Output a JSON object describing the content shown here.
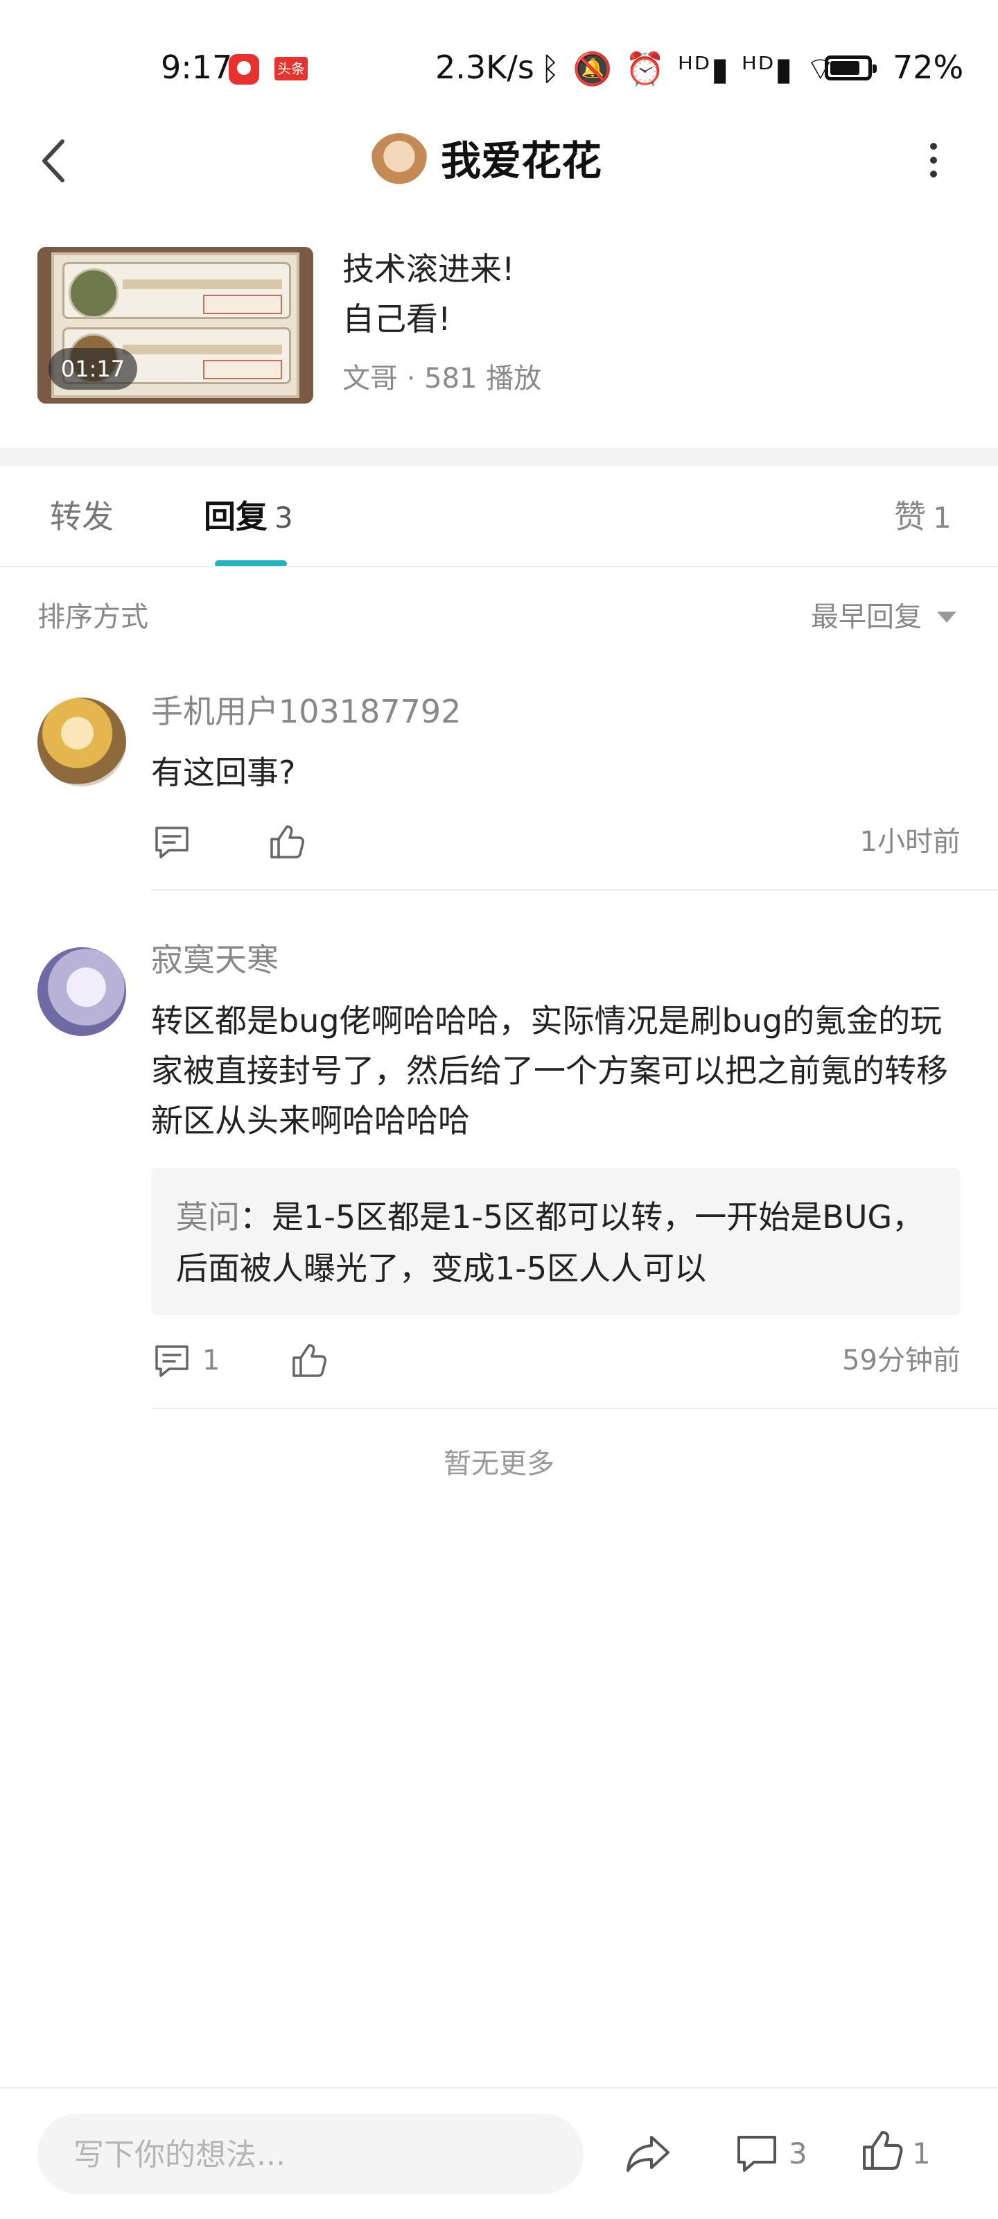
{
  "status_bar": {
    "time": "9:17",
    "app_badge": "头条",
    "speed": "2.3K/s",
    "icons": "ᛒ 🔕 ⏰ ᴴᴰ▮ ᴴᴰ▮ ⌔",
    "battery": "72%"
  },
  "header": {
    "title": "我爱花花",
    "back_icon": "chevron-left-icon",
    "more_icon": "more-vertical-icon"
  },
  "video": {
    "duration": "01:17",
    "title_line1": "技术滚进来!",
    "title_line2": "自己看!",
    "meta": "文哥 · 581 播放"
  },
  "tabs": {
    "repost": "转发",
    "reply": "回复",
    "reply_count": "3",
    "like": "赞",
    "like_count": "1"
  },
  "sort": {
    "label": "排序方式",
    "value": "最早回复"
  },
  "comments": [
    {
      "user": "手机用户103187792",
      "text": "有这回事?",
      "time": "1小时前",
      "reply_count": ""
    },
    {
      "user": "寂寞天寒",
      "text": "转区都是bug佬啊哈哈哈，实际情况是刷bug的氪金的玩家被直接封号了，然后给了一个方案可以把之前氪的转移新区从头来啊哈哈哈哈",
      "quote_user": "莫问",
      "quote_text": "：是1-5区都是1-5区都可以转，一开始是BUG，后面被人曝光了，变成1-5区人人可以",
      "time": "59分钟前",
      "reply_count": "1"
    }
  ],
  "footer_note": "暂无更多",
  "bottom_bar": {
    "input_placeholder": "写下你的想法...",
    "comment_count": "3",
    "like_count": "1"
  }
}
